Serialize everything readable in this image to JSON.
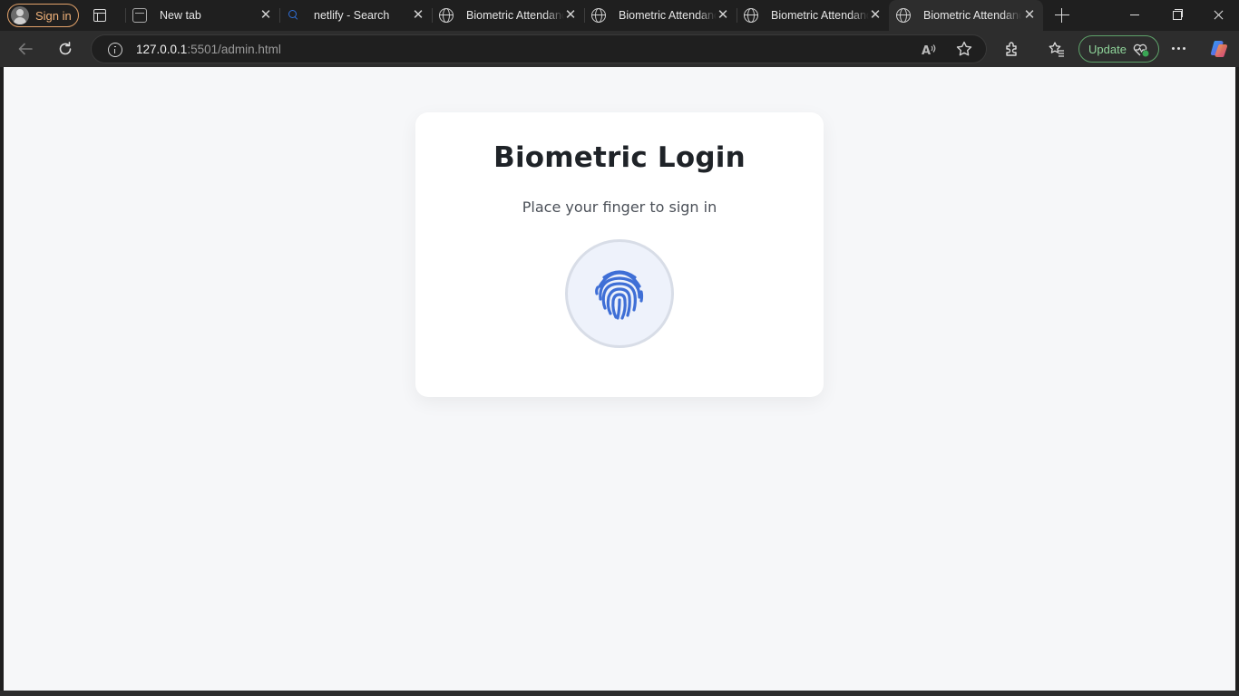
{
  "browser": {
    "profile": {
      "label": "Sign in"
    },
    "tabs": [
      {
        "title": "New tab",
        "icon": "new-tab-page-icon"
      },
      {
        "title": "netlify - Search",
        "icon": "search-icon"
      },
      {
        "title": "Biometric Attendance",
        "icon": "globe-icon"
      },
      {
        "title": "Biometric Attendance",
        "icon": "globe-icon"
      },
      {
        "title": "Biometric Attendance",
        "icon": "globe-icon"
      },
      {
        "title": "Biometric Attendance",
        "icon": "globe-icon",
        "active": true
      }
    ],
    "address": {
      "host": "127.0.0.1",
      "path": ":5501/admin.html"
    },
    "update_button": {
      "label": "Update"
    },
    "colors": {
      "accent_profile": "#e2a26a",
      "update_green": "#5ea36a",
      "fingerprint_blue": "#3f6fd6"
    }
  },
  "page": {
    "title": "Biometric Login",
    "subtitle": "Place your finger to sign in",
    "scanner_icon": "fingerprint-icon"
  }
}
